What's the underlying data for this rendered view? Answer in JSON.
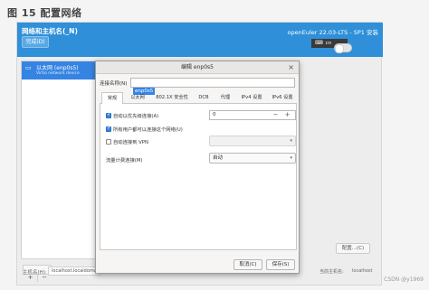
{
  "figure_caption": "图 15 配置网络",
  "header": {
    "title": "网络和主机名(_N)",
    "done_label": "完成(D)",
    "product": "openEuler 22.03-LTS - SP1 安装",
    "keyboard": "cn",
    "keyboard_icon": "keyboard-icon"
  },
  "interfaces": [
    {
      "name": "以太网 (enp0s5)",
      "subtitle": "Virtio network device",
      "icon": "network-wired-icon"
    }
  ],
  "left_buttons": {
    "add": "+",
    "remove": "−"
  },
  "configure_label": "配置...(C)",
  "hostname": {
    "label": "主机名(H):",
    "value": "localhost.localdomain"
  },
  "current_hostname": {
    "label": "当前主机名:",
    "value": "localhost"
  },
  "dialog": {
    "title": "编辑 enp0s5",
    "close_icon": "close-icon",
    "connection_name_label": "连接名称(N)",
    "connection_name_value": "enp0s5",
    "tabs": [
      "常规",
      "以太网",
      "802.1X 安全性",
      "DCB",
      "代理",
      "IPv4 设置",
      "IPv6 设置"
    ],
    "active_tab": "常规",
    "general": {
      "auto_connect_priority": {
        "label": "自动以优先级连接(A)",
        "checked": true,
        "value": "0"
      },
      "all_users": {
        "label": "所有用户都可以连接这个网络(U)",
        "checked": true
      },
      "auto_vpn": {
        "label": "自动连接到 VPN",
        "checked": false,
        "value": ""
      },
      "metered": {
        "label": "流量计费连接(M)",
        "value": "自动"
      }
    },
    "cancel_label": "取消(C)",
    "save_label": "保存(S)"
  },
  "watermark": "CSDN @y1969",
  "colors": {
    "accent": "#3584e4",
    "header": "#2f8fd8"
  }
}
